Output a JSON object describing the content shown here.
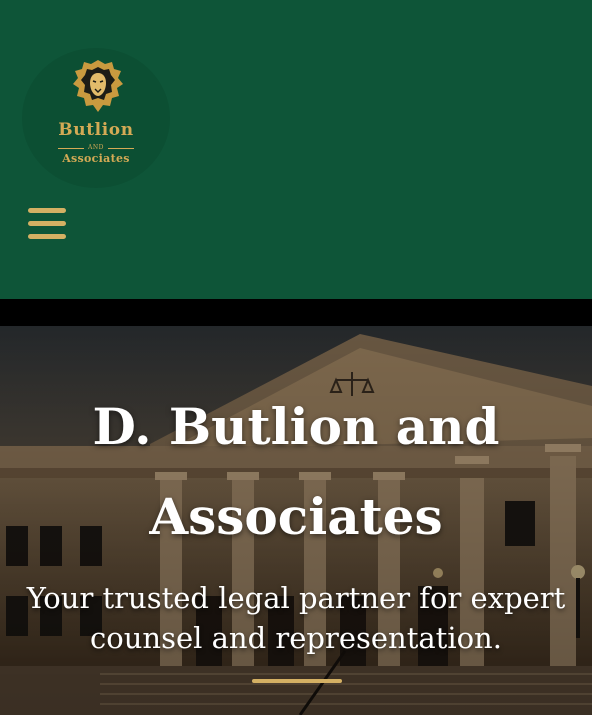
{
  "header": {
    "background_color": "#0e5538",
    "logo": {
      "name": "Butlion",
      "connector": "AND",
      "subtitle": "Associates",
      "icon": "lion-head-icon",
      "color": "#d4aa55"
    },
    "menu_icon": "hamburger-menu-icon"
  },
  "hero": {
    "title": "D. Butlion and Associates",
    "subtitle": "Your trusted legal partner for expert counsel and representation.",
    "background_image": "courthouse-building",
    "accent_color": "#d4b063"
  }
}
